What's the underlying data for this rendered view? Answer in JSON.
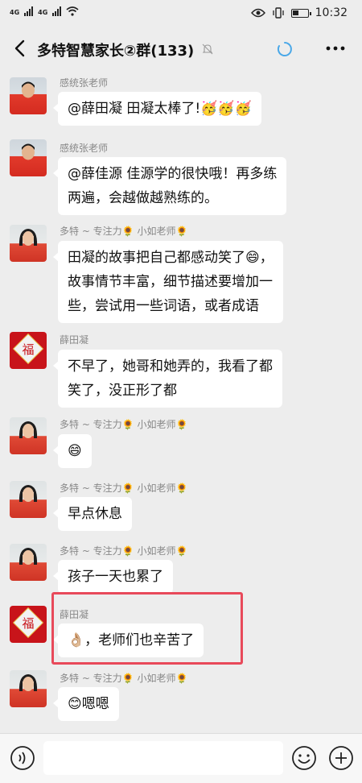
{
  "status_bar": {
    "network_1": "4G",
    "network_2": "4G",
    "time": "10:32"
  },
  "header": {
    "title": "多特智慧家长②群(133)"
  },
  "messages": [
    {
      "sender": "感统张老师",
      "avatar": "boy-avatar",
      "lines": [
        "@薛田凝  田凝太棒了!🥳🥳🥳"
      ]
    },
    {
      "sender": "感统张老师",
      "avatar": "boy-avatar",
      "lines": [
        "@薛佳源  佳源学的很快哦！再多练",
        "两遍，会越做越熟练的。"
      ]
    },
    {
      "sender": "多特 ~ 专注力🌻 小如老师🌻",
      "avatar": "girl-avatar",
      "lines": [
        "田凝的故事把自己都感动笑了😄，",
        "故事情节丰富，细节描述要增加一",
        "些，尝试用一些词语，或者成语"
      ]
    },
    {
      "sender": "薛田凝",
      "avatar": "red-fu-avatar",
      "lines": [
        "不早了，她哥和她弄的，我看了都",
        "笑了，没正形了都"
      ]
    },
    {
      "sender": "多特 ~ 专注力🌻 小如老师🌻",
      "avatar": "girl-avatar",
      "lines": [
        "😄"
      ]
    },
    {
      "sender": "多特 ~ 专注力🌻 小如老师🌻",
      "avatar": "girl-avatar",
      "lines": [
        "早点休息"
      ]
    },
    {
      "sender": "多特 ~ 专注力🌻 小如老师🌻",
      "avatar": "girl-avatar",
      "lines": [
        "孩子一天也累了"
      ]
    },
    {
      "sender": "薛田凝",
      "avatar": "red-fu-avatar",
      "lines": [
        "👌🏼，老师们也辛苦了"
      ]
    },
    {
      "sender": "多特 ~ 专注力🌻 小如老师🌻",
      "avatar": "girl-avatar",
      "lines": [
        "😊嗯嗯"
      ]
    }
  ],
  "avatar_glyphs": {
    "red_fu": "福"
  },
  "colors": {
    "background": "#ededed",
    "highlight": "#e8495a",
    "refresh": "#4aa8e8"
  }
}
